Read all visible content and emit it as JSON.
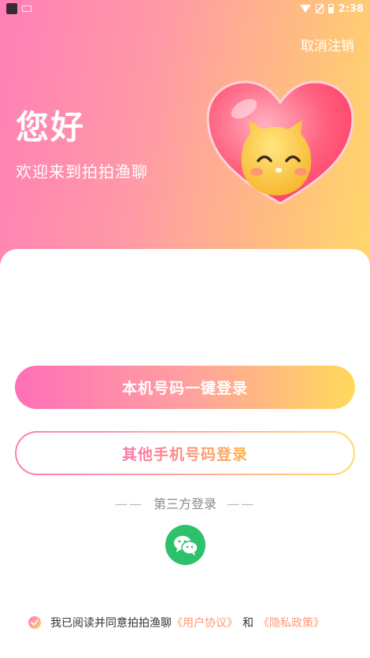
{
  "status_bar": {
    "time": "2:38"
  },
  "header": {
    "cancel_label": "取消注销",
    "greeting": "您好",
    "welcome": "欢迎来到拍拍渔聊"
  },
  "login": {
    "one_click_label": "本机号码一键登录",
    "other_phone_label": "其他手机号码登录",
    "third_party_label": "第三方登录",
    "third_party_dash": "——"
  },
  "agreement": {
    "prefix": "我已阅读并同意拍拍渔聊",
    "user_agreement": "《用户协议》",
    "and": "和",
    "privacy_policy": "《隐私政策》"
  },
  "colors": {
    "gradient_pink": "#ff7fb6",
    "gradient_yellow": "#ffd86a",
    "wechat_green": "#2ec16b"
  }
}
